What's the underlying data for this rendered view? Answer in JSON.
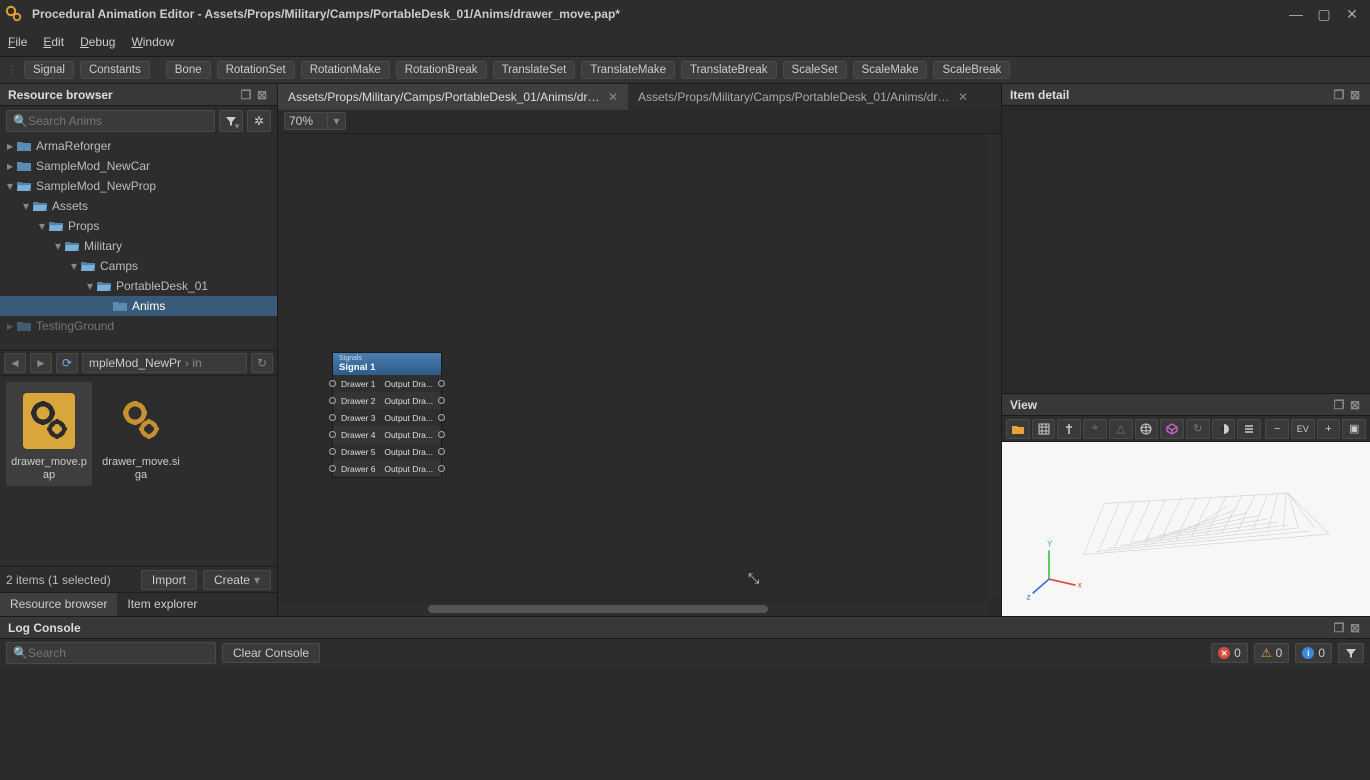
{
  "window": {
    "title": "Procedural Animation Editor - Assets/Props/Military/Camps/PortableDesk_01/Anims/drawer_move.pap*"
  },
  "menu": {
    "items": [
      "File",
      "Edit",
      "Debug",
      "Window"
    ]
  },
  "toolbar": {
    "chips": [
      "Signal",
      "Constants",
      "Bone",
      "RotationSet",
      "RotationMake",
      "RotationBreak",
      "TranslateSet",
      "TranslateMake",
      "TranslateBreak",
      "ScaleSet",
      "ScaleMake",
      "ScaleBreak"
    ]
  },
  "left": {
    "title": "Resource browser",
    "search_placeholder": "Search Anims",
    "tree": [
      {
        "d": 0,
        "exp": "c",
        "name": "ArmaReforger"
      },
      {
        "d": 0,
        "exp": "c",
        "name": "SampleMod_NewCar"
      },
      {
        "d": 0,
        "exp": "o",
        "name": "SampleMod_NewProp"
      },
      {
        "d": 1,
        "exp": "o",
        "name": "Assets"
      },
      {
        "d": 2,
        "exp": "o",
        "name": "Props"
      },
      {
        "d": 3,
        "exp": "o",
        "name": "Military"
      },
      {
        "d": 4,
        "exp": "o",
        "name": "Camps"
      },
      {
        "d": 5,
        "exp": "o",
        "name": "PortableDesk_01"
      },
      {
        "d": 6,
        "exp": "n",
        "name": "Anims",
        "sel": true
      },
      {
        "d": 0,
        "exp": "c",
        "name": "TestingGround",
        "cut": true
      }
    ],
    "crumb": "mpleMod_NewPr",
    "crumb_trail": "› in",
    "thumbs": [
      {
        "name": "drawer_move.pap",
        "sel": true,
        "color": "#d9a63c"
      },
      {
        "name": "drawer_move.siga",
        "sel": false,
        "color": "#c79030"
      }
    ],
    "status": "2 items (1 selected)",
    "import_btn": "Import",
    "create_btn": "Create",
    "tabs": [
      "Resource browser",
      "Item explorer"
    ],
    "active_tab": 0
  },
  "center": {
    "tabs": [
      {
        "label": "Assets/Props/Military/Camps/PortableDesk_01/Anims/drawer...",
        "active": true
      },
      {
        "label": "Assets/Props/Military/Camps/PortableDesk_01/Anims/drawer_...",
        "active": false
      }
    ],
    "zoom": "70%",
    "node": {
      "subtitle": "Signals",
      "title": "Signal 1",
      "rows": [
        {
          "in": "Drawer 1",
          "out": "Output Dra..."
        },
        {
          "in": "Drawer 2",
          "out": "Output Dra..."
        },
        {
          "in": "Drawer 3",
          "out": "Output Dra..."
        },
        {
          "in": "Drawer 4",
          "out": "Output Dra..."
        },
        {
          "in": "Drawer 5",
          "out": "Output Dra..."
        },
        {
          "in": "Drawer 6",
          "out": "Output Dra..."
        }
      ]
    }
  },
  "right": {
    "detail_title": "Item detail",
    "view_title": "View"
  },
  "log": {
    "title": "Log Console",
    "search_placeholder": "Search",
    "clear_btn": "Clear Console",
    "counts": {
      "err": "0",
      "warn": "0",
      "info": "0"
    }
  }
}
